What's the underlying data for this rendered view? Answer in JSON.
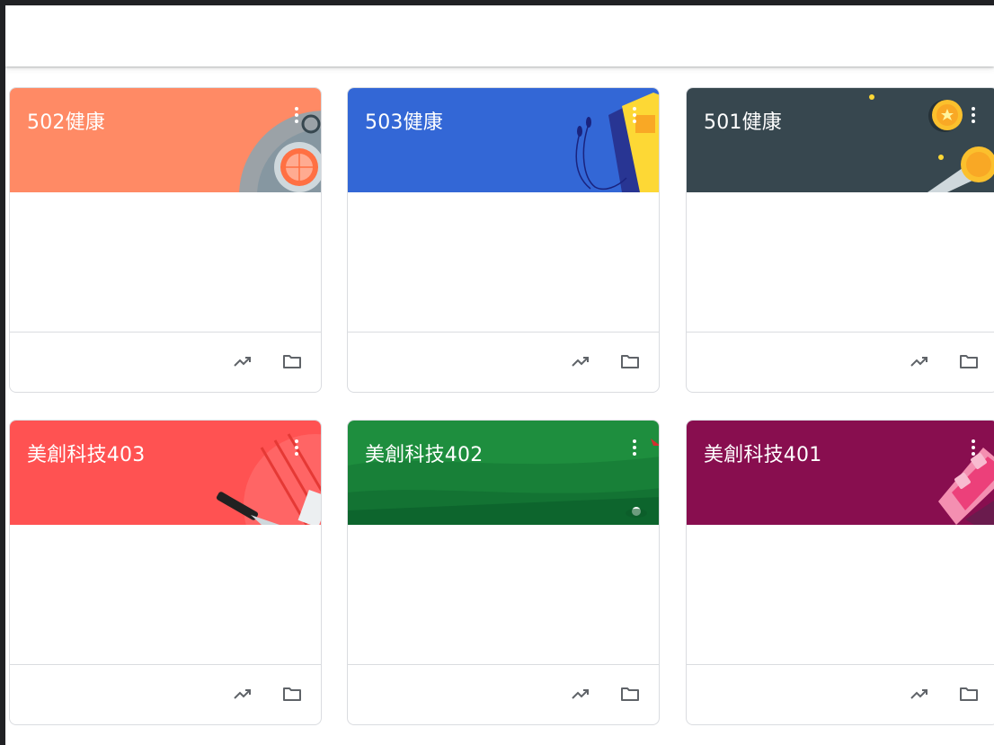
{
  "cards": [
    {
      "title": "502健康",
      "color": "#ff8a65",
      "more_icon": "more-vert-icon",
      "footer_icons": [
        "trending-up-icon",
        "folder-icon"
      ]
    },
    {
      "title": "503健康",
      "color": "#3367d6",
      "more_icon": "more-vert-icon",
      "footer_icons": [
        "trending-up-icon",
        "folder-icon"
      ]
    },
    {
      "title": "501健康",
      "color": "#37474f",
      "more_icon": "more-vert-icon",
      "footer_icons": [
        "trending-up-icon",
        "folder-icon"
      ]
    },
    {
      "title": "美創科技403",
      "color": "#ff5252",
      "more_icon": "more-vert-icon",
      "footer_icons": [
        "trending-up-icon",
        "folder-icon"
      ]
    },
    {
      "title": "美創科技402",
      "color": "#1e8e3e",
      "more_icon": "more-vert-icon",
      "footer_icons": [
        "trending-up-icon",
        "folder-icon"
      ]
    },
    {
      "title": "美創科技401",
      "color": "#880e4f",
      "more_icon": "more-vert-icon",
      "footer_icons": [
        "trending-up-icon",
        "folder-icon"
      ]
    }
  ]
}
